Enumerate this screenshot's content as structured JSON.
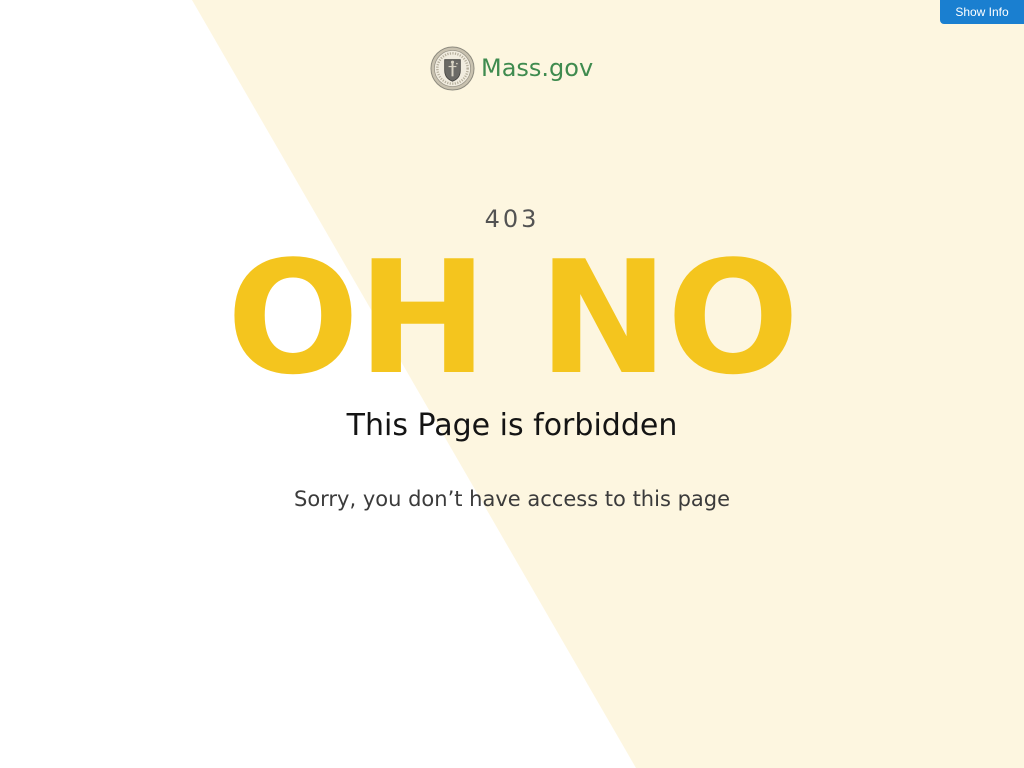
{
  "toolbar": {
    "show_info_label": "Show Info"
  },
  "header": {
    "logo_text": "Mass.gov",
    "logo_icon": "massachusetts-seal-icon"
  },
  "error": {
    "code": "403",
    "headline": "OH NO",
    "title": "This Page is forbidden",
    "message": "Sorry, you don’t have access to this page"
  },
  "colors": {
    "background": "#ffffff",
    "diagonal_panel": "#fdf6e0",
    "headline": "#f4c51e",
    "logo_green": "#3f8b4f",
    "button_blue": "#1a7fd0"
  }
}
